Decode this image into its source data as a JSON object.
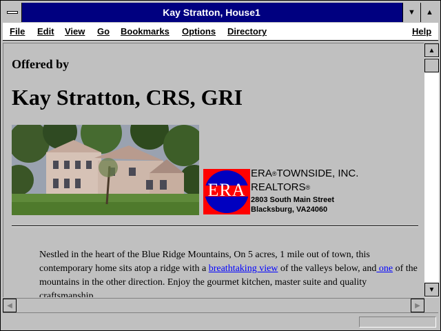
{
  "window": {
    "title": "Kay Stratton, House1"
  },
  "menubar": {
    "items": [
      {
        "key": "file",
        "label": "File"
      },
      {
        "key": "edit",
        "label": "Edit"
      },
      {
        "key": "view",
        "label": "View"
      },
      {
        "key": "go",
        "label": "Go"
      },
      {
        "key": "bookmarks",
        "label": "Bookmarks"
      },
      {
        "key": "options",
        "label": "Options"
      },
      {
        "key": "directory",
        "label": "Directory"
      }
    ],
    "help": "Help"
  },
  "page": {
    "offered_by": "Offered by",
    "agent_name": "Kay Stratton, CRS, GRI",
    "logo_text": "ERA",
    "broker": {
      "name_part1": "ERA",
      "name_part2": "TOWNSIDE, INC.",
      "line2": "REALTORS",
      "reg_mark": "®",
      "street": "2803 South Main Street",
      "city": "Blacksburg, VA24060"
    },
    "description": {
      "part1": "Nestled in the heart of the Blue Ridge Mountains, On 5 acres, 1 mile out of town, this contemporary home sits atop a ridge with a ",
      "link1": "breathtaking view",
      "part2": " of the valleys below, and",
      "link2": " one",
      "part3": " of the mountains in the other direction. Enjoy the gourmet kitchen, master suite and quality craftsmanship."
    }
  },
  "icons": {
    "system_menu": "system-menu-icon",
    "minimize": "minimize-icon",
    "maximize": "maximize-icon",
    "scroll_up": "scroll-up-icon",
    "scroll_down": "scroll-down-icon",
    "scroll_left": "scroll-left-icon",
    "scroll_right": "scroll-right-icon"
  },
  "colors": {
    "title_bar": "#000080",
    "link": "#0000ff",
    "logo_red": "#ff0000",
    "logo_blue": "#0000c0"
  }
}
